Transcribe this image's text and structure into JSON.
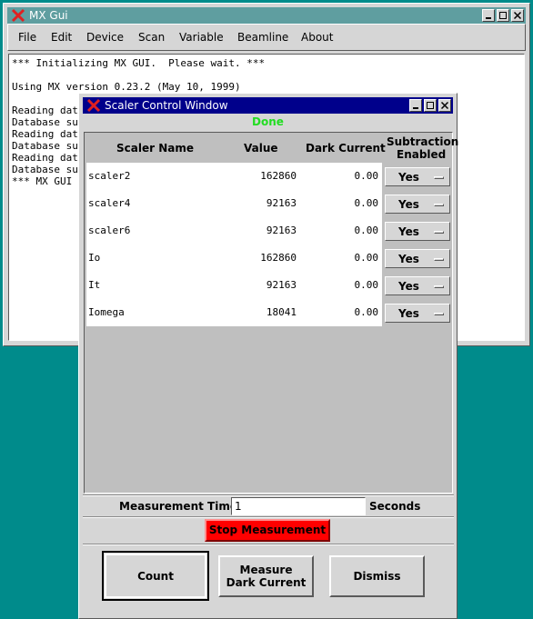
{
  "main_window": {
    "title": "MX Gui",
    "menu": [
      "File",
      "Edit",
      "Device",
      "Scan",
      "Variable",
      "Beamline",
      "About"
    ],
    "console_lines": [
      "*** Initializing MX GUI.  Please wait. ***",
      "",
      "Using MX version 0.23.2 (May 10, 1999)",
      "",
      "Reading dat",
      "Database su",
      "Reading dat",
      "Database su",
      "Reading dat",
      "Database su",
      "*** MX GUI "
    ]
  },
  "scaler_window": {
    "title": "Scaler Control Window",
    "status": "Done",
    "status_color": "#22dd22",
    "headers": {
      "name": "Scaler Name",
      "value": "Value",
      "dark": "Dark Current",
      "sub1": "Subtraction",
      "sub2": "Enabled"
    },
    "rows": [
      {
        "name": "scaler2",
        "value": "162860",
        "dark": "0.00",
        "enabled": "Yes"
      },
      {
        "name": "scaler4",
        "value": "92163",
        "dark": "0.00",
        "enabled": "Yes"
      },
      {
        "name": "scaler6",
        "value": "92163",
        "dark": "0.00",
        "enabled": "Yes"
      },
      {
        "name": "Io",
        "value": "162860",
        "dark": "0.00",
        "enabled": "Yes"
      },
      {
        "name": "It",
        "value": "92163",
        "dark": "0.00",
        "enabled": "Yes"
      },
      {
        "name": "Iomega",
        "value": "18041",
        "dark": "0.00",
        "enabled": "Yes"
      }
    ],
    "measurement_label": "Measurement Time:",
    "measurement_value": "1",
    "measurement_unit": "Seconds",
    "stop_label": "Stop Measurement",
    "buttons": {
      "count": "Count",
      "measure1": "Measure",
      "measure2": "Dark Current",
      "dismiss": "Dismiss"
    }
  },
  "colors": {
    "desktop": "#008b8b",
    "titlebar_inactive": "#5f9ea0",
    "titlebar_active": "#00008b",
    "stop": "#ff0000"
  }
}
